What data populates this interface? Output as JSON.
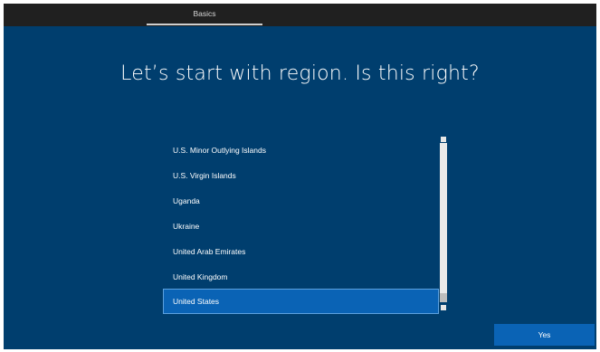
{
  "topbar": {
    "tab_label": "Basics"
  },
  "main": {
    "heading": "Let’s start with region. Is this right?"
  },
  "region_list": {
    "items": [
      {
        "label": "U.S. Minor Outlying Islands",
        "selected": false
      },
      {
        "label": "U.S. Virgin Islands",
        "selected": false
      },
      {
        "label": "Uganda",
        "selected": false
      },
      {
        "label": "Ukraine",
        "selected": false
      },
      {
        "label": "United Arab Emirates",
        "selected": false
      },
      {
        "label": "United Kingdom",
        "selected": false
      },
      {
        "label": "United States",
        "selected": true
      }
    ]
  },
  "footer": {
    "yes_label": "Yes"
  },
  "colors": {
    "background": "#003e6e",
    "accent": "#0a63b5",
    "topbar": "#202020"
  }
}
